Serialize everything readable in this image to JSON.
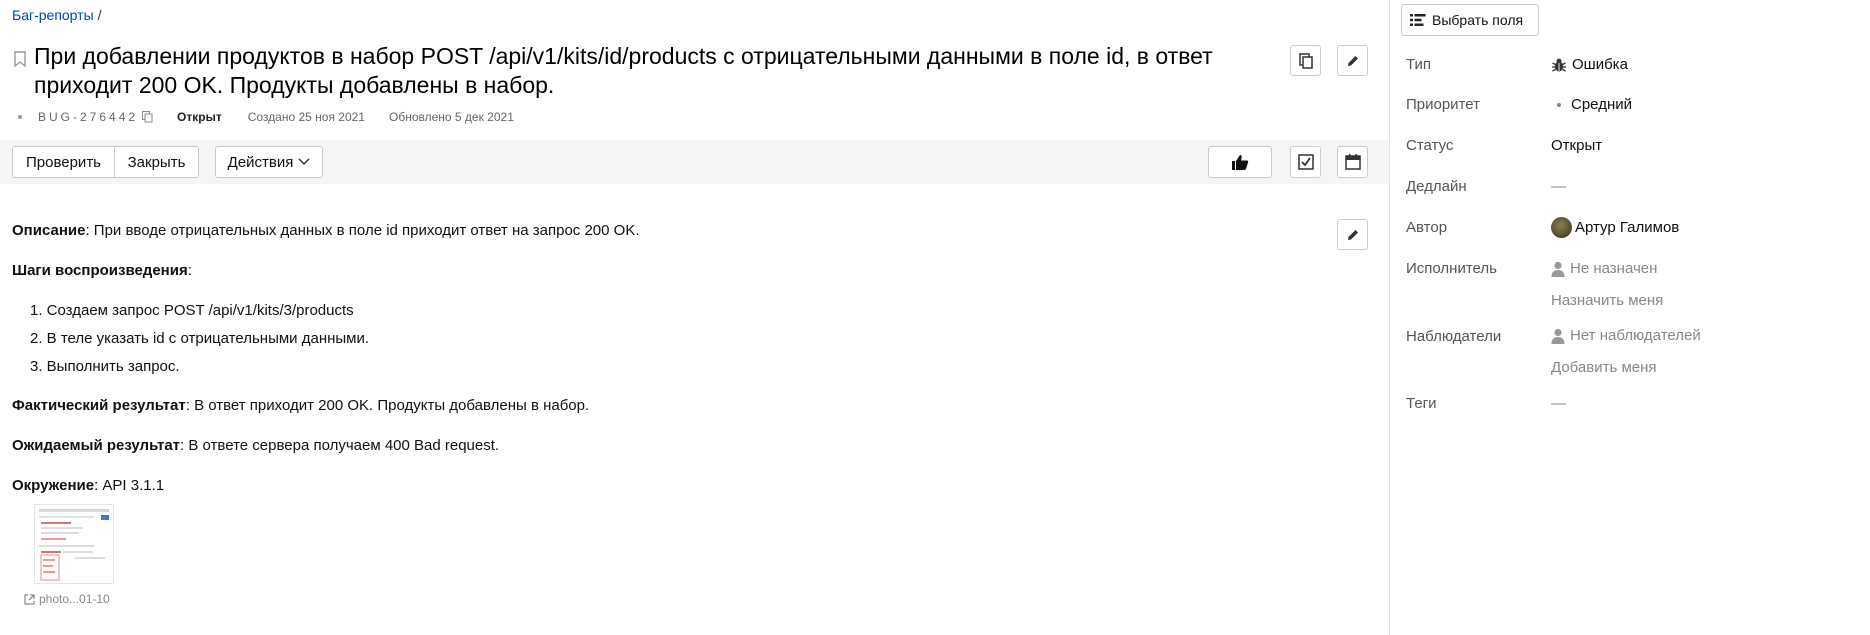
{
  "breadcrumb": {
    "link": "Баг-репорты",
    "sep": "/"
  },
  "issue": {
    "title": "При добавлении продуктов в набор POST /api/v1/kits/id/products с отрицательными данными в поле id, в ответ приходит 200 OK. Продукты добавлены в набор.",
    "key": "BUG-276442",
    "status": "Открыт",
    "created": "Создано 25 ноя 2021",
    "updated": "Обновлено 5 дек 2021"
  },
  "toolbar": {
    "check": "Проверить",
    "close": "Закрыть",
    "actions": "Действия"
  },
  "description": {
    "desc_label": "Описание",
    "desc_text": ": При вводе отрицательных данных в поле id приходит ответ на запрос 200 OK.",
    "steps_label": "Шаги воспроизведения",
    "steps_colon": ":",
    "steps": [
      "1. Создаем запрос POST /api/v1/kits/3/products",
      "2. В теле указать id с отрицательными данными.",
      "3. Выполнить запрос."
    ],
    "actual_label": "Фактический результат",
    "actual_text": ": В ответ приходит 200 OK. Продукты добавлены в набор.",
    "expected_label": "Ожидаемый результат",
    "expected_text": ": В ответе сервера получаем 400 Bad request.",
    "env_label": "Окружение",
    "env_text": ": API 3.1.1",
    "attachment": "photo...01-10"
  },
  "sidebar": {
    "pick_fields": "Выбрать поля",
    "type_label": "Тип",
    "type_value": "Ошибка",
    "priority_label": "Приоритет",
    "priority_value": "Средний",
    "status_label": "Статус",
    "status_value": "Открыт",
    "deadline_label": "Дедлайн",
    "deadline_value": "—",
    "author_label": "Автор",
    "author_value": "Артур Галимов",
    "assignee_label": "Исполнитель",
    "assignee_value": "Не назначен",
    "assign_me": "Назначить меня",
    "watchers_label": "Наблюдатели",
    "watchers_value": "Нет наблюдателей",
    "add_me": "Добавить меня",
    "tags_label": "Теги",
    "tags_value": "—"
  },
  "colors": {
    "link": "#0044bb",
    "toolbar_bg": "#f5f5f3",
    "bug_icon": "#333333"
  }
}
